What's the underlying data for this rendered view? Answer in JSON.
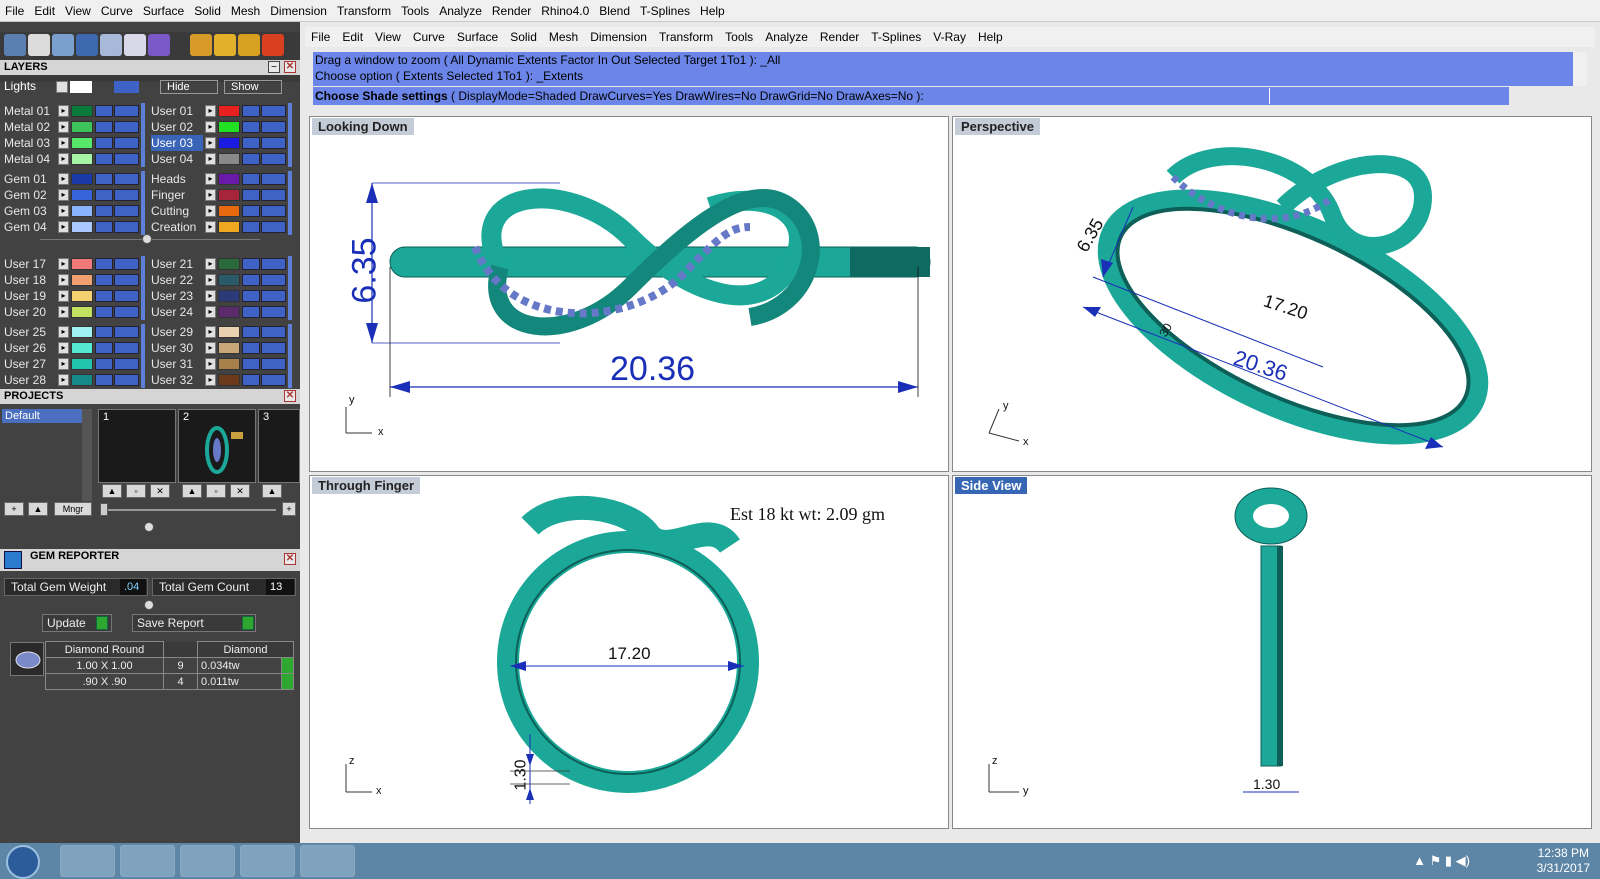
{
  "top_menu": [
    "File",
    "Edit",
    "View",
    "Curve",
    "Surface",
    "Solid",
    "Mesh",
    "Dimension",
    "Transform",
    "Tools",
    "Analyze",
    "Render",
    "Rhino4.0",
    "Blend",
    "T-Splines",
    "Help"
  ],
  "layers_panel": {
    "title": "LAYERS",
    "lights_label": "Lights",
    "hide_label": "Hide",
    "show_label": "Show",
    "left": [
      {
        "name": "Metal 01",
        "color": "#0a7a3a"
      },
      {
        "name": "Metal 02",
        "color": "#3cc45a"
      },
      {
        "name": "Metal 03",
        "color": "#56e66a"
      },
      {
        "name": "Metal 04",
        "color": "#a5f5a5"
      },
      {
        "name": "Gem 01",
        "color": "#1a3aa8"
      },
      {
        "name": "Gem 02",
        "color": "#3563d8"
      },
      {
        "name": "Gem 03",
        "color": "#8ab4ff"
      },
      {
        "name": "Gem 04",
        "color": "#a8c8ff"
      },
      {
        "name": "User 17",
        "color": "#f07a7a"
      },
      {
        "name": "User 18",
        "color": "#f0a070"
      },
      {
        "name": "User 19",
        "color": "#f4d070"
      },
      {
        "name": "User 20",
        "color": "#c4e060"
      },
      {
        "name": "User 25",
        "color": "#9ff0f0"
      },
      {
        "name": "User 26",
        "color": "#55e8d0"
      },
      {
        "name": "User 27",
        "color": "#22c4b0"
      },
      {
        "name": "User 28",
        "color": "#158a88"
      }
    ],
    "right": [
      {
        "name": "User 01",
        "color": "#e82020"
      },
      {
        "name": "User 02",
        "color": "#22e022"
      },
      {
        "name": "User 03",
        "color": "#1a1ae0"
      },
      {
        "name": "User 04",
        "color": "#8a8a8a"
      },
      {
        "name": "Heads",
        "color": "#6a1aa8"
      },
      {
        "name": "Finger",
        "color": "#a8243a"
      },
      {
        "name": "Cutting",
        "color": "#e86a10"
      },
      {
        "name": "Creation",
        "color": "#f0a820"
      },
      {
        "name": "User 21",
        "color": "#2a6a3a"
      },
      {
        "name": "User 22",
        "color": "#2a5a6a"
      },
      {
        "name": "User 23",
        "color": "#2a3a7a"
      },
      {
        "name": "User 24",
        "color": "#5a2a6a"
      },
      {
        "name": "User 29",
        "color": "#e8d0b0"
      },
      {
        "name": "User 30",
        "color": "#c8a878"
      },
      {
        "name": "User 31",
        "color": "#a8804a"
      },
      {
        "name": "User 32",
        "color": "#6a3a1a"
      }
    ]
  },
  "projects_panel": {
    "title": "PROJECTS",
    "default_label": "Default",
    "thumbs": [
      "1",
      "2",
      "3"
    ],
    "mngr_label": "Mngr"
  },
  "gem_reporter": {
    "title": "GEM REPORTER",
    "total_weight_label": "Total Gem Weight",
    "total_weight_value": ".04",
    "total_count_label": "Total Gem Count",
    "total_count_value": "13",
    "update_label": "Update",
    "save_report_label": "Save Report",
    "table": {
      "headers": [
        "Diamond Round",
        "",
        "Diamond"
      ],
      "rows": [
        {
          "size": "1.00 X 1.00",
          "count": "9",
          "weight": "0.034tw"
        },
        {
          "size": ".90 X .90",
          "count": "4",
          "weight": "0.011tw"
        }
      ]
    }
  },
  "command_menu": [
    "File",
    "Edit",
    "View",
    "Curve",
    "Surface",
    "Solid",
    "Mesh",
    "Dimension",
    "Transform",
    "Tools",
    "Analyze",
    "Render",
    "T-Splines",
    "V-Ray",
    "Help"
  ],
  "command_history": [
    "Drag a window to zoom ( All  Dynamic  Extents  Factor  In  Out  Selected  Target  1To1 ): _All",
    "Choose option ( Extents  Selected  1To1 ): _Extents"
  ],
  "command_prompt": {
    "prefix": "Choose Shade settings",
    "options": " ( DisplayMode=Shaded  DrawCurves=Yes  DrawWires=No  DrawGrid=No  DrawAxes=No ):"
  },
  "viewports": {
    "looking_down": {
      "title": "Looking Down",
      "dim_height": "6.35",
      "dim_width": "20.36"
    },
    "perspective": {
      "title": "Perspective",
      "dim_a": "6.35",
      "dim_b": "17.20",
      "dim_c": "20.36",
      "dim_d": "30"
    },
    "through_finger": {
      "title": "Through Finger",
      "dim_inner": "17.20",
      "dim_thick": "1.30",
      "weight_note": "Est 18 kt wt: 2.09 gm"
    },
    "side_view": {
      "title": "Side View",
      "dim_thick": "1.30"
    }
  },
  "axes": {
    "x": "x",
    "y": "y",
    "z": "z"
  },
  "taskbar": {
    "time": "12:38 PM",
    "date": "3/31/2017"
  },
  "colors": {
    "ring": "#1ba898",
    "ring_dark": "#0d5f58",
    "gem": "#6678c8",
    "dim": "#1a2fb8",
    "cmd_bg": "#6b86e8"
  }
}
